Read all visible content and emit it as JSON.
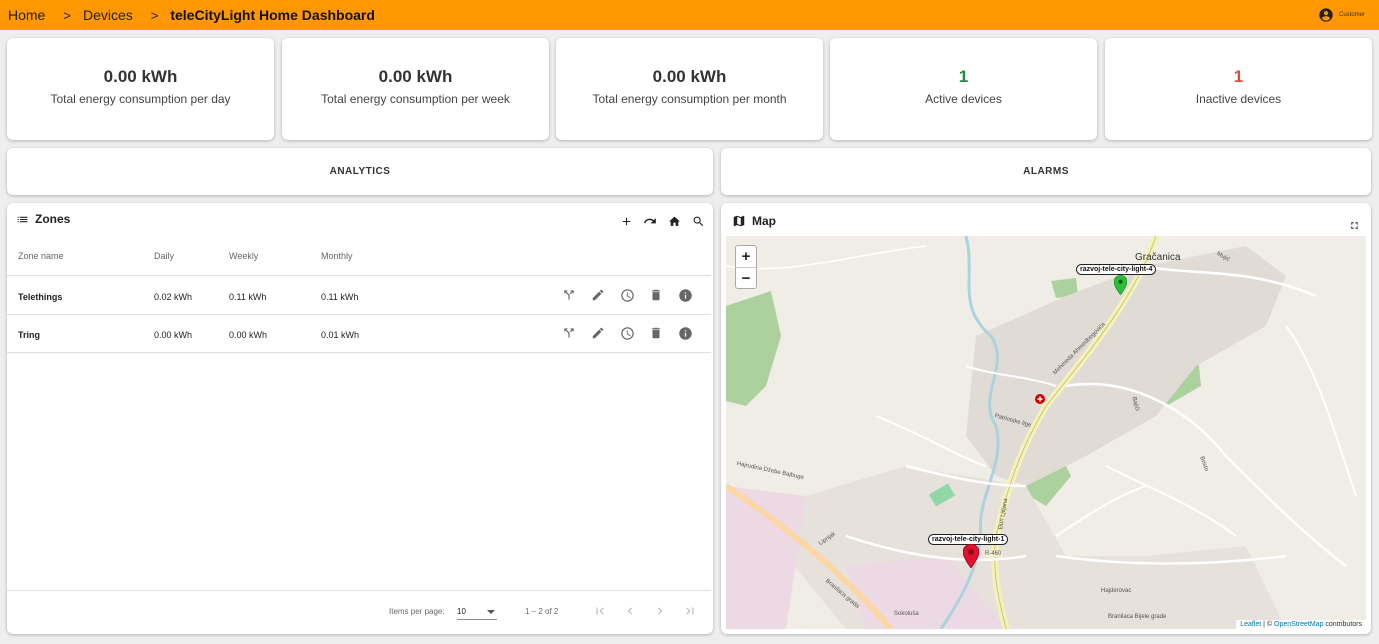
{
  "breadcrumb": {
    "home": "Home",
    "devices": "Devices",
    "separator": ">",
    "current": "teleCityLight Home Dashboard"
  },
  "user": {
    "label": "Customer"
  },
  "stats": [
    {
      "value": "0.00 kWh",
      "label": "Total energy consumption per day"
    },
    {
      "value": "0.00 kWh",
      "label": "Total energy consumption per week"
    },
    {
      "value": "0.00 kWh",
      "label": "Total energy consumption per month"
    },
    {
      "value": "1",
      "label": "Active devices",
      "color": "#1e8e3e"
    },
    {
      "value": "1",
      "label": "Inactive devices",
      "color": "#e04b3c"
    }
  ],
  "nav": {
    "analytics": "ANALYTICS",
    "alarms": "ALARMS"
  },
  "zones": {
    "title": "Zones",
    "columns": [
      "Zone name",
      "Daily",
      "Weekly",
      "Monthly"
    ],
    "rows": [
      {
        "name": "Telethings",
        "daily": "0.02 kWh",
        "weekly": "0.11 kWh",
        "monthly": "0.11 kWh"
      },
      {
        "name": "Tring",
        "daily": "0.00 kWh",
        "weekly": "0.00 kWh",
        "monthly": "0.01 kWh"
      }
    ],
    "pager": {
      "items_per_page_label": "Items per page:",
      "items_per_page": "10",
      "range": "1 – 2 of 2"
    }
  },
  "map": {
    "title": "Map",
    "zoom_in": "+",
    "zoom_out": "−",
    "town": "Gračanica",
    "road_label": "R-460",
    "street_labels": [
      "Mehmeda Ahmedbegovića",
      "Hajrudina Džebe Bajbuge",
      "Branilaca grada",
      "Sokoluša",
      "Branilaca Bijele grade",
      "Lipnjak",
      "Patriotske lige",
      "Hajderovac",
      "Mujić",
      "Bajići",
      "Bristo",
      "Đuri Ljiljana"
    ],
    "markers": [
      {
        "label": "razvoj-tele-city-light-4",
        "color": "#2bbf3a"
      },
      {
        "label": "razvoj-tele-city-light-1",
        "color": "#e0102e"
      }
    ],
    "attribution": {
      "leaflet": "Leaflet",
      "separator": " | © ",
      "osm": "OpenStreetMap",
      "suffix": " contributors"
    }
  },
  "colors": {
    "topbar": "#ff9800",
    "accent_green": "#1e8e3e",
    "accent_red": "#e04b3c"
  }
}
